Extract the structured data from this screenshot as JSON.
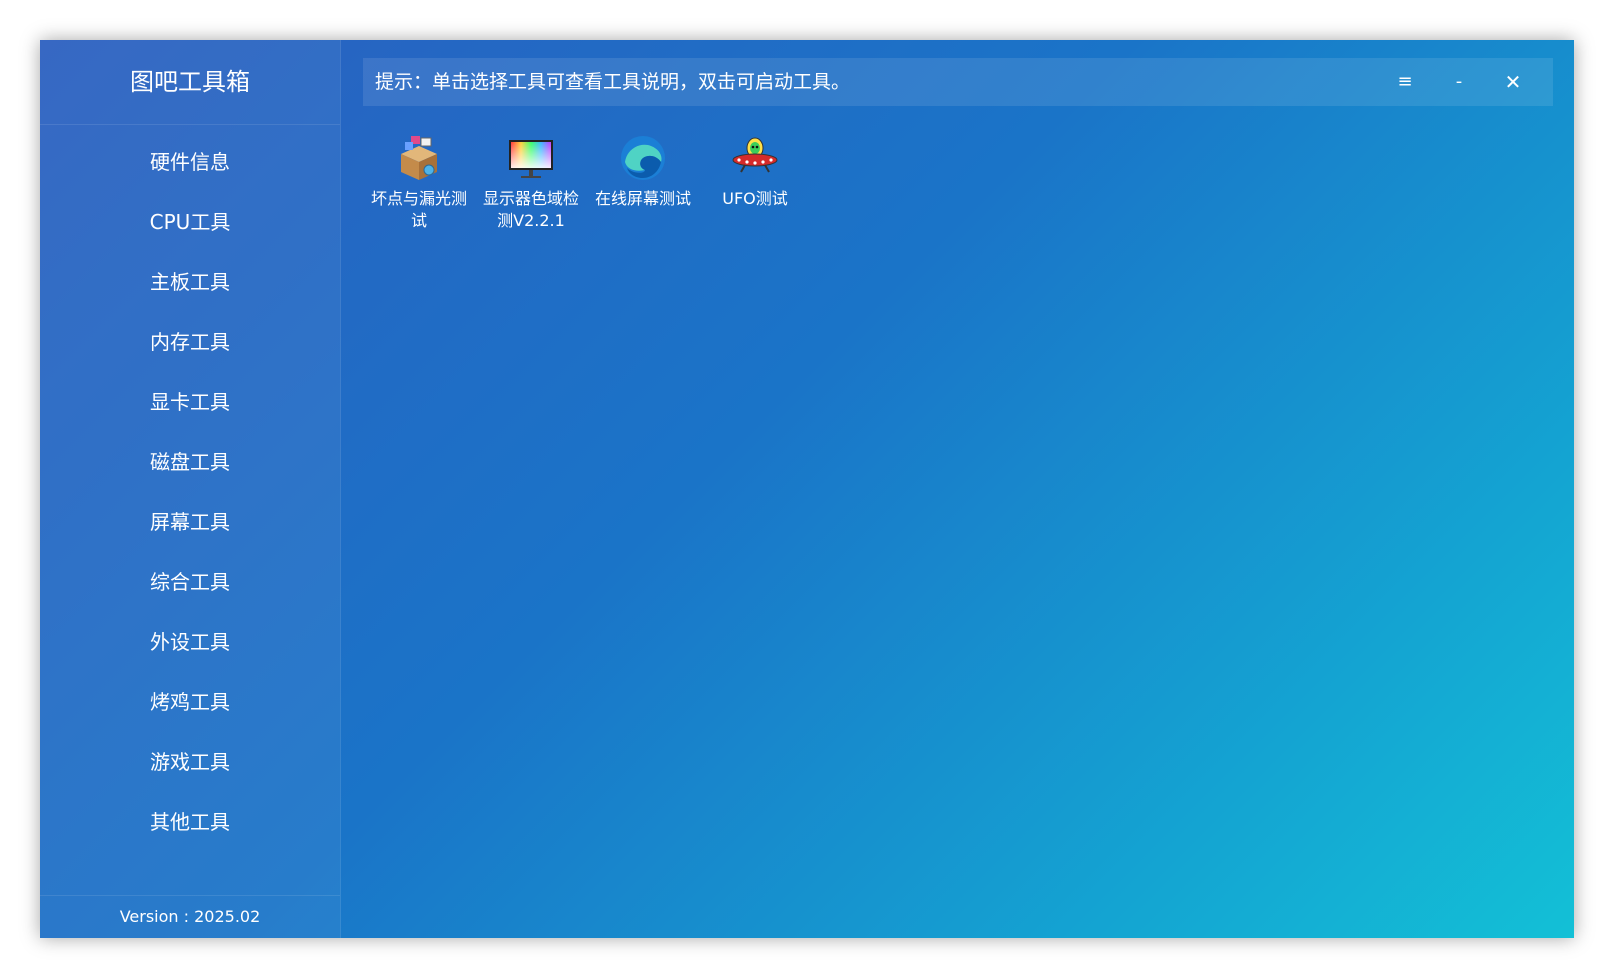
{
  "app": {
    "title": "图吧工具箱",
    "version": "Version : 2025.02"
  },
  "sidebar": {
    "items": [
      {
        "label": "硬件信息"
      },
      {
        "label": "CPU工具"
      },
      {
        "label": "主板工具"
      },
      {
        "label": "内存工具"
      },
      {
        "label": "显卡工具"
      },
      {
        "label": "磁盘工具"
      },
      {
        "label": "屏幕工具"
      },
      {
        "label": "综合工具"
      },
      {
        "label": "外设工具"
      },
      {
        "label": "烤鸡工具"
      },
      {
        "label": "游戏工具"
      },
      {
        "label": "其他工具"
      }
    ]
  },
  "header": {
    "hint": "提示：单击选择工具可查看工具说明，双击可启动工具。",
    "menu_glyph": "≡",
    "minimize_glyph": "-",
    "close_glyph": "✕"
  },
  "tools": [
    {
      "label": "坏点与漏光测试",
      "icon": "package-box-icon"
    },
    {
      "label": "显示器色域检测V2.2.1",
      "icon": "monitor-color-icon"
    },
    {
      "label": "在线屏幕测试",
      "icon": "edge-browser-icon"
    },
    {
      "label": "UFO测试",
      "icon": "ufo-icon"
    }
  ],
  "colors": {
    "gradient_start": "#2b5fc0",
    "gradient_end": "#13c0d6",
    "text": "#ffffff"
  }
}
